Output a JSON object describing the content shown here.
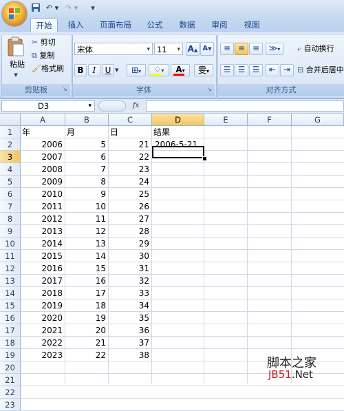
{
  "ribbon_tabs": [
    "开始",
    "插入",
    "页面布局",
    "公式",
    "数据",
    "审阅",
    "视图"
  ],
  "clipboard": {
    "paste": "粘贴",
    "cut": "剪切",
    "copy": "复制",
    "format_painter": "格式刷",
    "group_label": "剪贴板"
  },
  "font": {
    "name": "宋体",
    "size": "11",
    "bold": "B",
    "italic": "I",
    "underline": "U",
    "font_color_letter": "A",
    "phonetic": "雯",
    "grow": "A",
    "shrink": "A",
    "group_label": "字体"
  },
  "alignment": {
    "wrap_text": "自动换行",
    "merge_center": "合并后居中",
    "group_label": "对齐方式"
  },
  "formula_bar": {
    "name_box": "D3",
    "fx": "fx",
    "content": ""
  },
  "columns": [
    "A",
    "B",
    "C",
    "D",
    "E",
    "F",
    "G"
  ],
  "rows": [
    "1",
    "2",
    "3",
    "4",
    "5",
    "6",
    "7",
    "8",
    "9",
    "10",
    "11",
    "12",
    "13",
    "14",
    "15",
    "16",
    "17",
    "18",
    "19",
    "20",
    "21",
    "22",
    "23"
  ],
  "headers": {
    "A": "年",
    "B": "月",
    "C": "日",
    "D": "结果"
  },
  "data_rows": [
    {
      "year": "2006",
      "month": "5",
      "day": "21",
      "result": "2006-5-21"
    },
    {
      "year": "2007",
      "month": "6",
      "day": "22",
      "result": ""
    },
    {
      "year": "2008",
      "month": "7",
      "day": "23",
      "result": ""
    },
    {
      "year": "2009",
      "month": "8",
      "day": "24",
      "result": ""
    },
    {
      "year": "2010",
      "month": "9",
      "day": "25",
      "result": ""
    },
    {
      "year": "2011",
      "month": "10",
      "day": "26",
      "result": ""
    },
    {
      "year": "2012",
      "month": "11",
      "day": "27",
      "result": ""
    },
    {
      "year": "2013",
      "month": "12",
      "day": "28",
      "result": ""
    },
    {
      "year": "2014",
      "month": "13",
      "day": "29",
      "result": ""
    },
    {
      "year": "2015",
      "month": "14",
      "day": "30",
      "result": ""
    },
    {
      "year": "2016",
      "month": "15",
      "day": "31",
      "result": ""
    },
    {
      "year": "2017",
      "month": "16",
      "day": "32",
      "result": ""
    },
    {
      "year": "2018",
      "month": "17",
      "day": "33",
      "result": ""
    },
    {
      "year": "2019",
      "month": "18",
      "day": "34",
      "result": ""
    },
    {
      "year": "2020",
      "month": "19",
      "day": "35",
      "result": ""
    },
    {
      "year": "2021",
      "month": "20",
      "day": "36",
      "result": ""
    },
    {
      "year": "2022",
      "month": "21",
      "day": "37",
      "result": ""
    },
    {
      "year": "2023",
      "month": "22",
      "day": "38",
      "result": ""
    }
  ],
  "active_cell": "D3",
  "watermark": {
    "line1": "脚本之家",
    "line2_a": "JB51",
    "line2_b": ".Net"
  },
  "colors": {
    "accent": "#15428b",
    "selected_header": "#f5c563",
    "grid_line": "#d0d7e5"
  }
}
